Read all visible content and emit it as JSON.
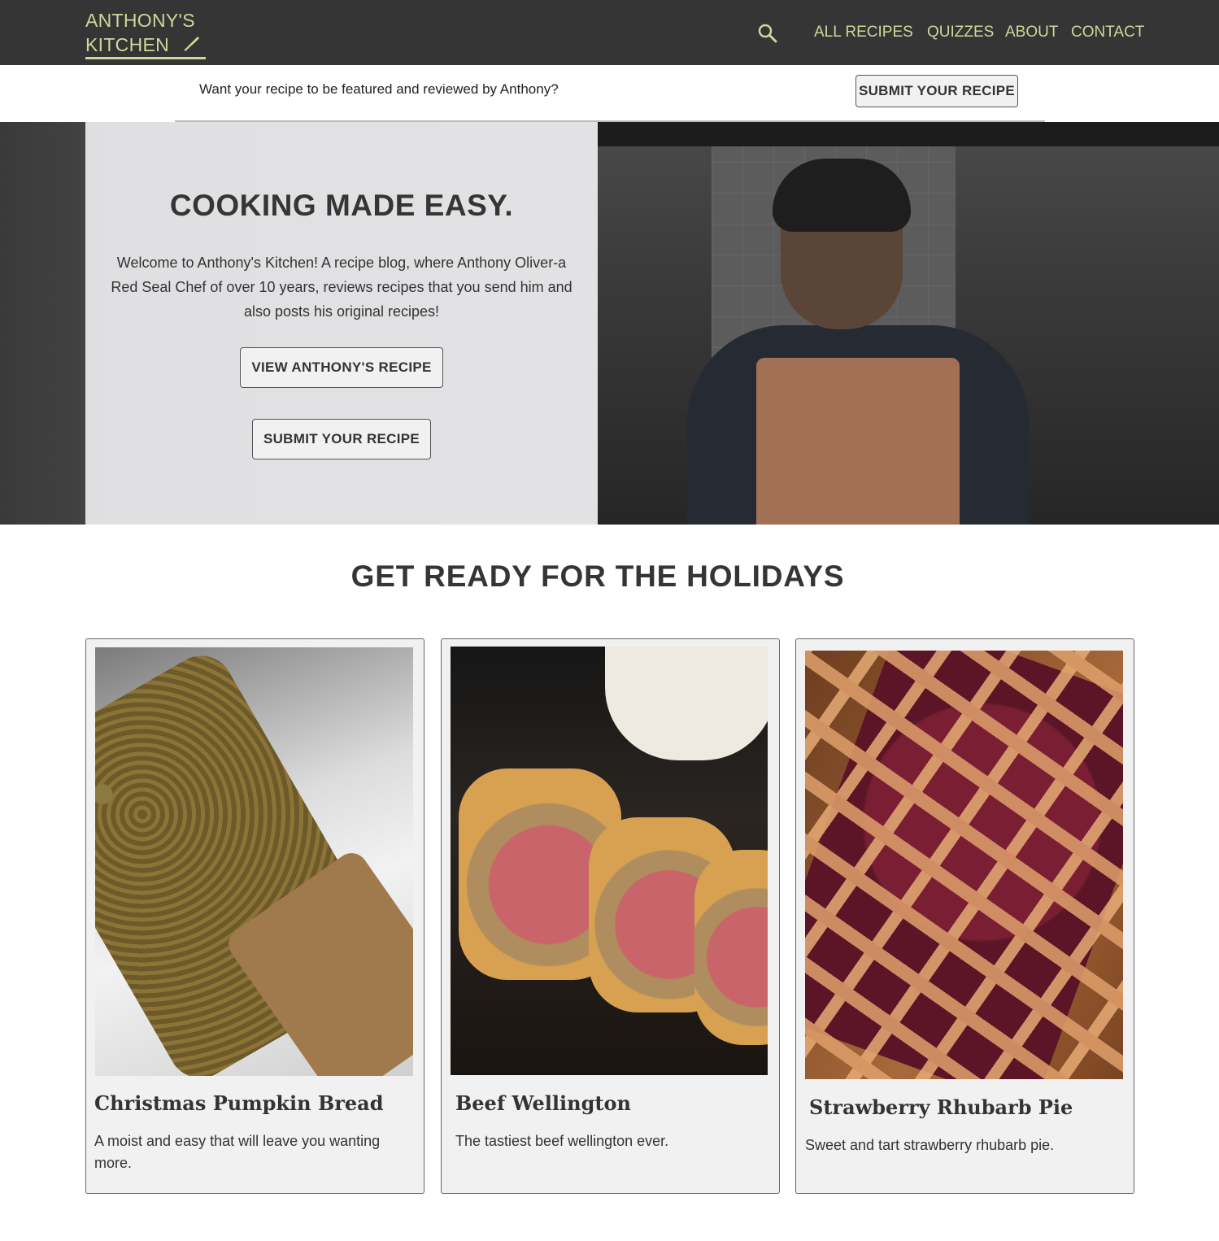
{
  "brand": {
    "line1": "ANTHONY'S",
    "line2": "KITCHEN"
  },
  "nav": {
    "links": [
      "ALL RECIPES",
      "QUIZZES",
      "ABOUT",
      "CONTACT"
    ]
  },
  "banner": {
    "text": "Want your recipe to be featured and reviewed by Anthony?",
    "button": "SUBMIT YOUR RECIPE"
  },
  "hero": {
    "title": "COOKING MADE EASY.",
    "text": "Welcome to Anthony's Kitchen!  A recipe blog, where Anthony Oliver-a Red Seal Chef of over 10 years, reviews recipes that you send him and also posts his original recipes!",
    "button1": "VIEW ANTHONY'S RECIPE",
    "button2": "SUBMIT YOUR RECIPE"
  },
  "section": {
    "title": "GET READY FOR THE HOLIDAYS"
  },
  "cards": [
    {
      "title": "Christmas Pumpkin Bread",
      "desc": "A moist and easy that will leave you wanting more."
    },
    {
      "title": "Beef Wellington",
      "desc": "The tastiest beef wellington ever."
    },
    {
      "title": "Strawberry Rhubarb Pie",
      "desc": "Sweet and tart strawberry rhubarb pie."
    }
  ],
  "colors": {
    "accent": "#cfd79a",
    "nav_bg": "#353535",
    "panel": "#ececee",
    "card_bg": "#f1f1f1"
  },
  "icons": {
    "search": "search-icon",
    "logo": "knife-icon"
  }
}
